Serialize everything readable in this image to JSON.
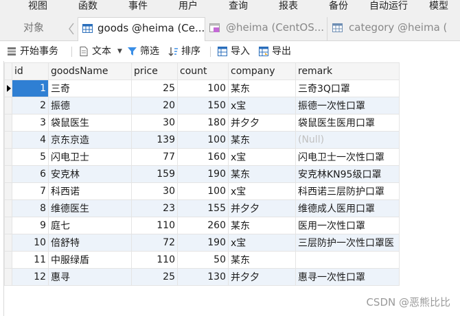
{
  "menu": [
    "视图",
    "函数",
    "事件",
    "用户",
    "查询",
    "报表",
    "备份",
    "自动运行",
    "模型"
  ],
  "tabs": {
    "objects": "对象",
    "nav_icon": "chevron-left-icon",
    "active": "goods @heima (Ce...",
    "inactive1": "@heima (CentOS...",
    "inactive2": "category @heima ("
  },
  "toolbar": {
    "begin_transaction": "开始事务",
    "text": "文本",
    "filter": "筛选",
    "sort": "排序",
    "import": "导入",
    "export": "导出"
  },
  "grid": {
    "columns": [
      "id",
      "goodsName",
      "price",
      "count",
      "company",
      "remark"
    ],
    "rows": [
      [
        "1",
        "三奇",
        "25",
        "100",
        "某东",
        "三奇3Q口罩"
      ],
      [
        "2",
        "振德",
        "20",
        "150",
        "x宝",
        "振德一次性口罩"
      ],
      [
        "3",
        "袋鼠医生",
        "30",
        "180",
        "并夕夕",
        "袋鼠医生医用口罩"
      ],
      [
        "4",
        "京东京造",
        "139",
        "100",
        "某东",
        "(Null)"
      ],
      [
        "5",
        "闪电卫士",
        "77",
        "160",
        "x宝",
        "闪电卫士一次性口罩"
      ],
      [
        "6",
        "安克林",
        "159",
        "190",
        "某东",
        "安克林KN95级口罩"
      ],
      [
        "7",
        "科西诺",
        "30",
        "100",
        "x宝",
        "科西诺三层防护口罩"
      ],
      [
        "8",
        "维德医生",
        "23",
        "155",
        "并夕夕",
        "维德成人医用口罩"
      ],
      [
        "9",
        "庭七",
        "110",
        "260",
        "某东",
        "医用一次性口罩"
      ],
      [
        "10",
        "倍舒特",
        "72",
        "190",
        "x宝",
        "三层防护一次性口罩医"
      ],
      [
        "11",
        "中服绿盾",
        "110",
        "50",
        "某东",
        ""
      ],
      [
        "12",
        "惠寻",
        "25",
        "130",
        "并夕夕",
        "惠寻一次性口罩"
      ]
    ]
  },
  "colors": {
    "selection": "#2f7fd3",
    "alt_row": "#edf3fa",
    "null_text": "#c0c0c0"
  },
  "watermark": "CSDN @恶熊比比"
}
